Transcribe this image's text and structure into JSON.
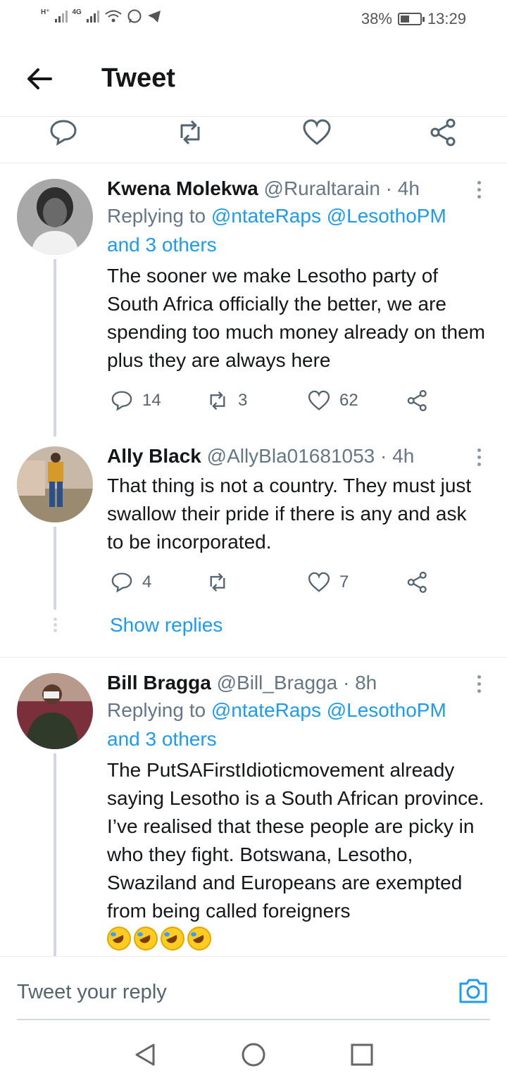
{
  "status_bar": {
    "network_1": "H⁺",
    "network_2": "4G",
    "battery": "38%",
    "time": "13:29"
  },
  "header": {
    "title": "Tweet",
    "back_icon": "arrow-left-icon"
  },
  "top_actions": {
    "icons": [
      "reply-icon",
      "retweet-icon",
      "like-icon",
      "share-icon"
    ]
  },
  "tweets": [
    {
      "name": "Kwena Molekwa",
      "handle": "@Ruraltarain",
      "time": " · 4h",
      "replying_prefix": "Replying to ",
      "replying_to": "@ntateRaps @LesothoPM",
      "replying_others": "and 3 others",
      "text": "The sooner we make Lesotho party of South Africa officially the better, we are spending too much money already on them plus they are always here",
      "replies": "14",
      "retweets": "3",
      "likes": "62"
    },
    {
      "name": "Ally Black",
      "handle": "@AllyBla01681053",
      "time": " · 4h",
      "text": "That thing is not a country. They must just swallow their pride if there is any and ask to be incorporated.",
      "replies": "4",
      "retweets": "",
      "likes": "7",
      "show_replies": "Show replies"
    },
    {
      "name": "Bill Bragga",
      "handle": "@Bill_Bragga",
      "time": " · 8h",
      "replying_prefix": "Replying to ",
      "replying_to": "@ntateRaps @LesothoPM",
      "replying_others": "and 3 others",
      "text": "The PutSAFirstIdioticmovement already saying Lesotho is a South African province. I’ve realised that these people are picky in who they fight. Botswana, Lesotho, Swaziland and Europeans are exempted from being called foreigners",
      "emoji": "🤣🤣🤣🤣"
    }
  ],
  "composer": {
    "placeholder": "Tweet your reply"
  },
  "colors": {
    "link": "#1d9bf0",
    "secondary_text": "#657786",
    "divider": "#e6ecf0"
  }
}
